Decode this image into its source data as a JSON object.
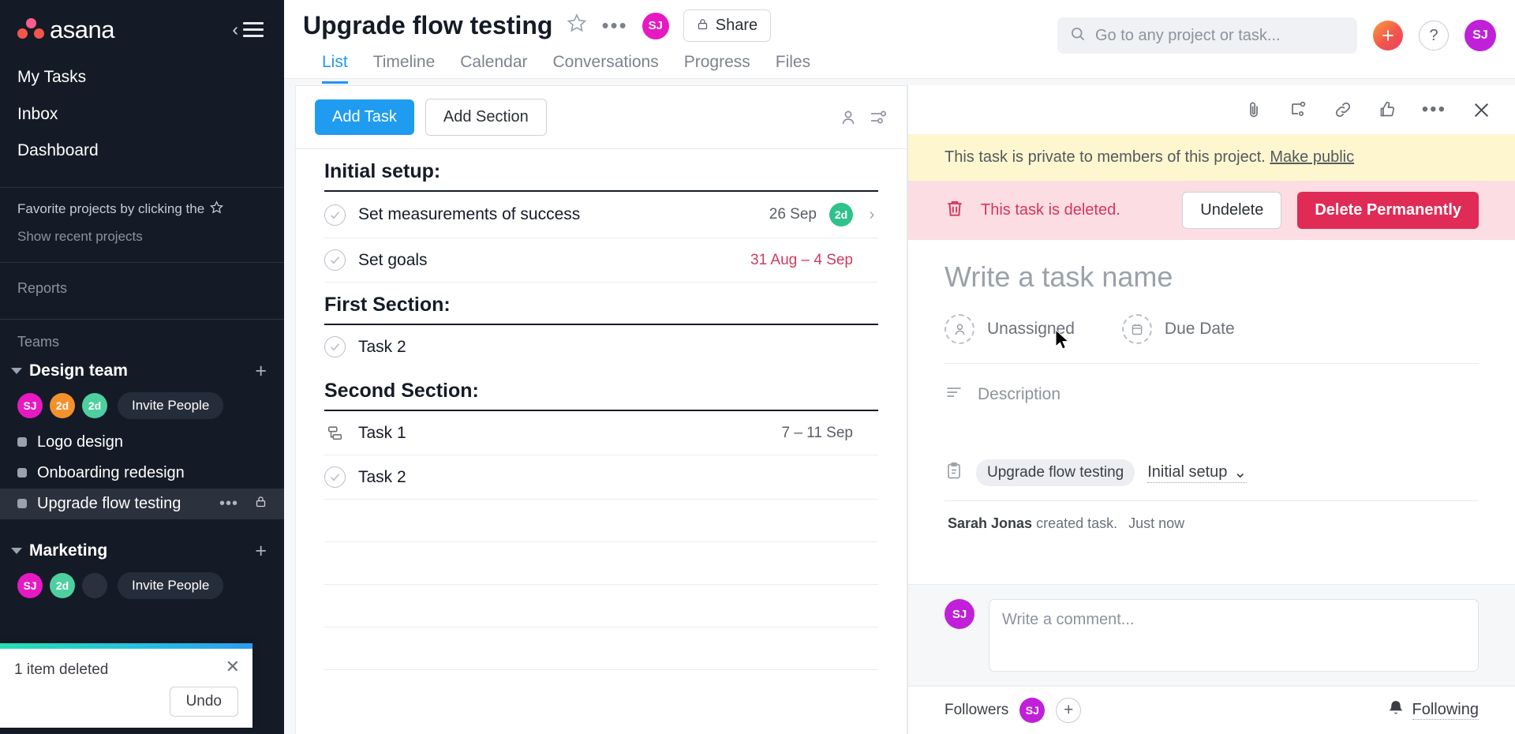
{
  "sidebar": {
    "brand": "asana",
    "nav": [
      {
        "label": "My Tasks",
        "name": "my-tasks"
      },
      {
        "label": "Inbox",
        "name": "inbox"
      },
      {
        "label": "Dashboard",
        "name": "dashboard"
      }
    ],
    "favorite_hint": "Favorite projects by clicking the",
    "show_recent": "Show recent projects",
    "reports_label": "Reports",
    "teams_label": "Teams",
    "teams": [
      {
        "name": "Design team",
        "avatars": [
          {
            "initials": "SJ",
            "color": "#e619c3"
          },
          {
            "initials": "2d",
            "color": "#f5912c"
          },
          {
            "initials": "2d",
            "color": "#4ecfa0"
          }
        ],
        "invite_label": "Invite People",
        "projects": [
          {
            "label": "Logo design",
            "active": false
          },
          {
            "label": "Onboarding redesign",
            "active": false
          },
          {
            "label": "Upgrade flow testing",
            "active": true
          }
        ]
      },
      {
        "name": "Marketing",
        "avatars": [
          {
            "initials": "SJ",
            "color": "#e619c3"
          },
          {
            "initials": "2d",
            "color": "#4ecfa0"
          },
          {
            "initials": "",
            "color": "#2a313e"
          }
        ],
        "invite_label": "Invite People",
        "projects": []
      }
    ],
    "toast": {
      "message": "1 item deleted",
      "undo_label": "Undo",
      "close_icon": "close-icon"
    }
  },
  "header": {
    "project_title": "Upgrade flow testing",
    "avatar_initials": "SJ",
    "share_label": "Share",
    "tabs": [
      {
        "label": "List",
        "active": true
      },
      {
        "label": "Timeline",
        "active": false
      },
      {
        "label": "Calendar",
        "active": false
      },
      {
        "label": "Conversations",
        "active": false
      },
      {
        "label": "Progress",
        "active": false
      },
      {
        "label": "Files",
        "active": false
      }
    ],
    "search_placeholder": "Go to any project or task...",
    "help_label": "?",
    "user_avatar_initials": "SJ"
  },
  "list": {
    "add_task_label": "Add Task",
    "add_section_label": "Add Section",
    "sections": [
      {
        "title": "Initial setup:",
        "tasks": [
          {
            "name": "Set measurements of success",
            "icon": "check-circle-icon",
            "date": "26 Sep",
            "date_overdue": false,
            "avatar": {
              "initials": "2d",
              "color": "#2fc28c"
            },
            "arrow": true
          },
          {
            "name": "Set goals",
            "icon": "check-circle-icon",
            "date": "31 Aug – 4 Sep",
            "date_overdue": true,
            "avatar": null,
            "arrow": false
          }
        ]
      },
      {
        "title": "First Section:",
        "tasks": [
          {
            "name": "Task 2",
            "icon": "check-circle-icon",
            "date": "",
            "date_overdue": false,
            "avatar": null,
            "arrow": false
          }
        ]
      },
      {
        "title": "Second Section:",
        "tasks": [
          {
            "name": "Task 1",
            "icon": "subtask-icon",
            "date": "7 – 11 Sep",
            "date_overdue": false,
            "avatar": null,
            "arrow": false
          },
          {
            "name": "Task 2",
            "icon": "check-circle-icon",
            "date": "",
            "date_overdue": false,
            "avatar": null,
            "arrow": false
          }
        ]
      }
    ],
    "empty_rows": 4
  },
  "detail": {
    "private_banner": "This task is private to members of this project.",
    "make_public_label": "Make public",
    "deleted_text": "This task is deleted.",
    "undelete_label": "Undelete",
    "delete_permanently_label": "Delete Permanently",
    "task_name_placeholder": "Write a task name",
    "assignee_label": "Unassigned",
    "due_date_label": "Due Date",
    "description_label": "Description",
    "project_tag": "Upgrade flow testing",
    "section_tag": "Initial setup",
    "story_author": "Sarah Jonas",
    "story_action": "created task.",
    "story_time": "Just now",
    "comment_placeholder": "Write a comment...",
    "comment_avatar_initials": "SJ",
    "followers_label": "Followers",
    "follower_initials": "SJ",
    "following_label": "Following"
  },
  "colors": {
    "accent_blue": "#1f9cf0",
    "sidebar_bg": "#151b26",
    "danger_red": "#e02b56",
    "warning_yellow": "#fdf6cf"
  }
}
